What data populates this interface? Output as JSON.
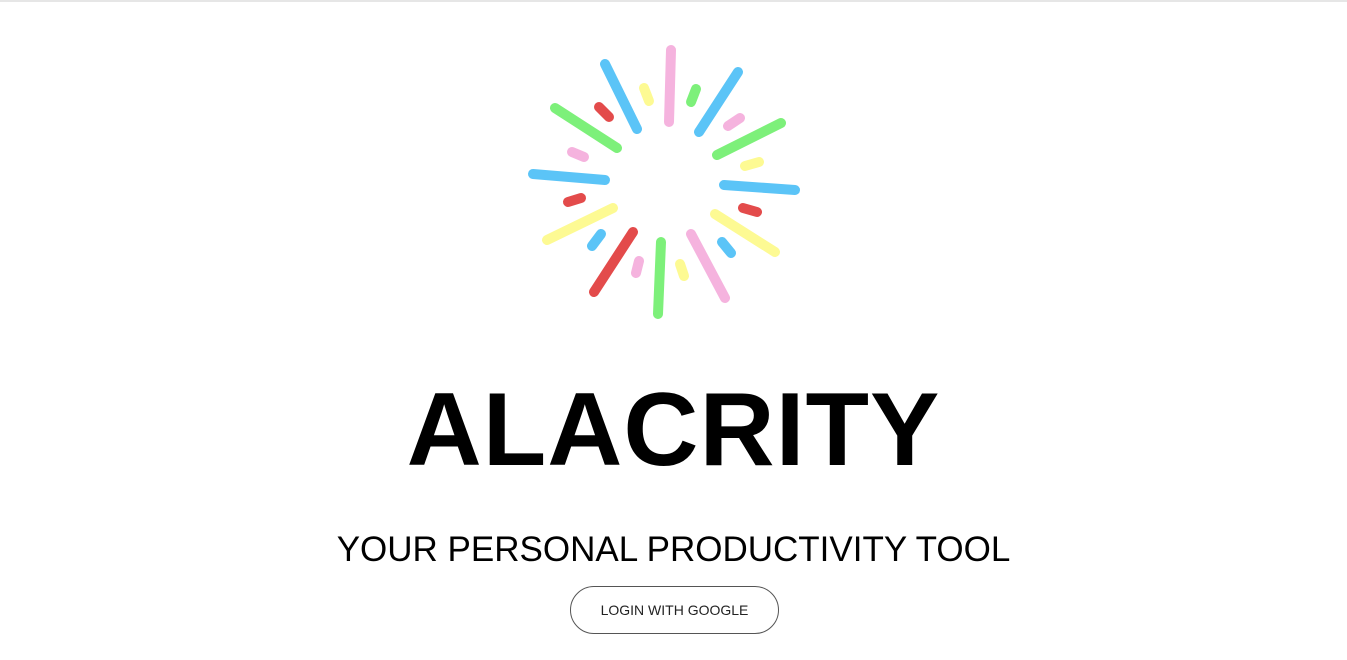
{
  "app": {
    "title": "ALACRITY",
    "tagline": "YOUR PERSONAL PRODUCTIVITY TOOL",
    "login_label": "LOGIN WITH GOOGLE"
  },
  "logo": {
    "icon": "burst-logo-icon",
    "colors": {
      "blue": "#5bc4f7",
      "green": "#7df07a",
      "pink": "#f5b3de",
      "yellow": "#fdfa93",
      "red": "#e34b4b"
    }
  }
}
